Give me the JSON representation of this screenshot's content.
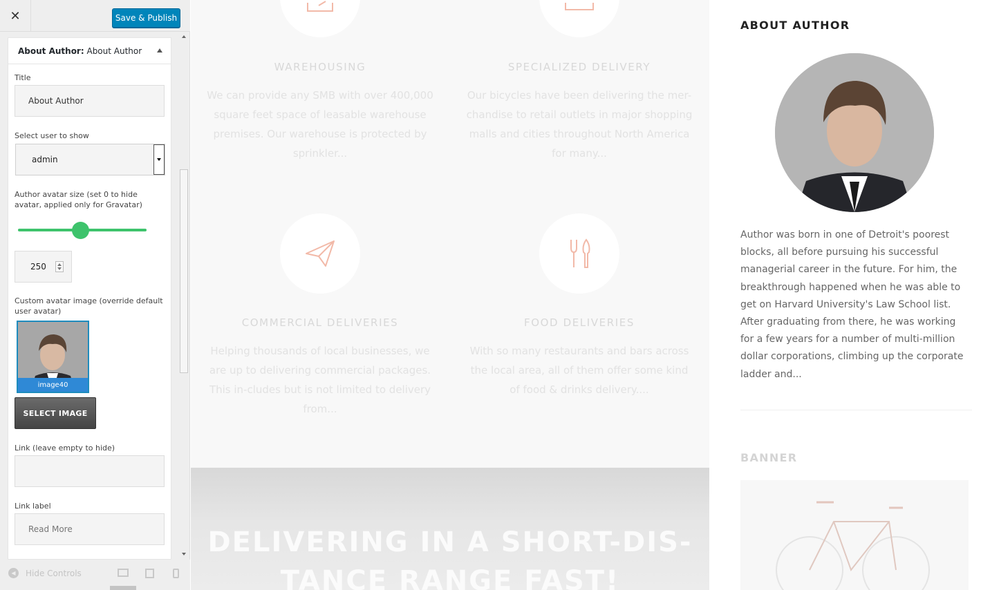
{
  "panel": {
    "close_label": "✕",
    "publish_label": "Save & Publish",
    "widget": {
      "title_prefix": "About Author:",
      "title_name": "About Author",
      "title_label": "Title",
      "title_value": "About Author",
      "user_label": "Select user to show",
      "user_value": "admin",
      "avatar_size_label": "Author avatar size (set 0 to hide avatar, applied only for Gravatar)",
      "avatar_size_value": "250",
      "custom_avatar_label": "Custom avatar image (override default user avatar)",
      "avatar_thumb_caption": "image40",
      "select_image_label": "SELECT IMAGE",
      "link_label": "Link (leave empty to hide)",
      "link_value": "",
      "link_text_label": "Link label",
      "link_text_value": "Read More"
    },
    "footer": {
      "hide_controls_label": "Hide Controls"
    }
  },
  "preview": {
    "services": [
      {
        "title": "WAREHOUSING",
        "text": "We can provide any SMB with over 400,000 square feet space of leasable warehouse premises. Our warehouse is protected by sprinkler...",
        "icon": "tag-icon"
      },
      {
        "title": "SPECIALIZED DELIVERY",
        "text": "Our bicycles have been delivering the mer-chandise to retail outlets in major shopping malls and cities throughout North America for many...",
        "icon": "box-icon"
      },
      {
        "title": "COMMERCIAL DELIVERIES",
        "text": "Helping thousands of local businesses, we are up to delivering commercial packages. This in-cludes but is not limited to delivery from...",
        "icon": "paper-plane-icon"
      },
      {
        "title": "FOOD DELIVERIES",
        "text": "With so many restaurants and bars across the local area, all of them offer some kind of food & drinks delivery....",
        "icon": "fork-knife-icon"
      }
    ],
    "hero_text": "DELIVERING IN A SHORT-DIS-TANCE RANGE FAST!"
  },
  "sidebar": {
    "about_title": "ABOUT AUTHOR",
    "bio": "Author was born in one of Detroit's poorest blocks, all before pursuing his successful managerial career in the future. For him, the breakthrough happened when he was able to get on Harvard University's Law School list. After graduating from there, he was working for a few years for a number of multi-million dollar corporations, climbing up the corporate ladder and...",
    "banner_title": "BANNER"
  },
  "colors": {
    "accent_blue": "#0085ba",
    "slider_green": "#3ec36c",
    "service_icon": "#f2b9a8"
  }
}
